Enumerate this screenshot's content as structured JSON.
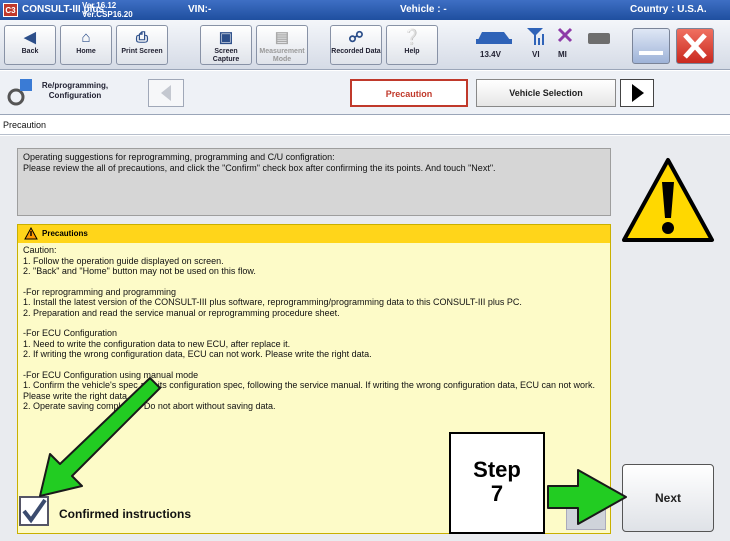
{
  "titlebar": {
    "app_name": "CONSULT-III plus",
    "version_line1": "Ver.16.12",
    "version_line2": "Ver.CSP16.20",
    "vin_label": "VIN:-",
    "vehicle_label": "Vehicle : -",
    "country_label": "Country : U.S.A."
  },
  "toolbar": {
    "buttons": [
      {
        "label": "Back",
        "icon": "back-arrow-icon"
      },
      {
        "label": "Home",
        "icon": "home-icon"
      },
      {
        "label": "Print Screen",
        "icon": "printer-icon"
      },
      {
        "label": "Screen Capture",
        "icon": "camera-icon"
      },
      {
        "label": "Measurement Mode",
        "icon": "meter-icon"
      },
      {
        "label": "Recorded Data",
        "icon": "recorded-data-icon"
      },
      {
        "label": "Help",
        "icon": "help-icon"
      }
    ],
    "status": {
      "voltage": "13.4V",
      "vi_label": "VI",
      "mi_label": "MI"
    },
    "colors": {
      "close": "#d9342b",
      "accent": "#2f63b8"
    }
  },
  "navbar": {
    "section_label": "Re/programming, Configuration",
    "tabs": [
      {
        "label": "Precaution"
      },
      {
        "label": "Vehicle Selection"
      }
    ]
  },
  "page": {
    "title": "Precaution",
    "suggestion": "Operating suggestions for reprogramming, programming and C/U configration:\nPlease review the all of precautions, and click the \"Confirm\" check box after confirming the its points. And touch \"Next\".",
    "precautions_heading": "Precautions",
    "caution_lines": [
      "Caution:",
      "1. Follow the operation guide displayed on screen.",
      "2. \"Back\" and  \"Home\" button may not be used on this flow.",
      "",
      "-For reprogramming and programming",
      "1. Install the latest version of the CONSULT-III plus software, reprogramming/programming data to this CONSULT-III plus PC.",
      "2. Preparation and read the service manual or reprogramming procedure sheet.",
      "",
      "-For ECU Configuration",
      "1. Need to write the configuration data to new ECU, after replace it.",
      "2. If writing the wrong configuration data, ECU can not work. Please write the right data.",
      "",
      "-For ECU Configuration using manual mode",
      "1. Confirm the vehicle's spec and its configuration spec, following the service manual. If writing the wrong configuration data, ECU can not work. Please write the right data.",
      "2. Operate saving completely. Do not abort without saving data."
    ],
    "confirm_label": "Confirmed instructions",
    "confirm_checked": true,
    "next_label": "Next",
    "step_label_line1": "Step",
    "step_label_line2": "7",
    "arrow_color": "#22cc22"
  }
}
